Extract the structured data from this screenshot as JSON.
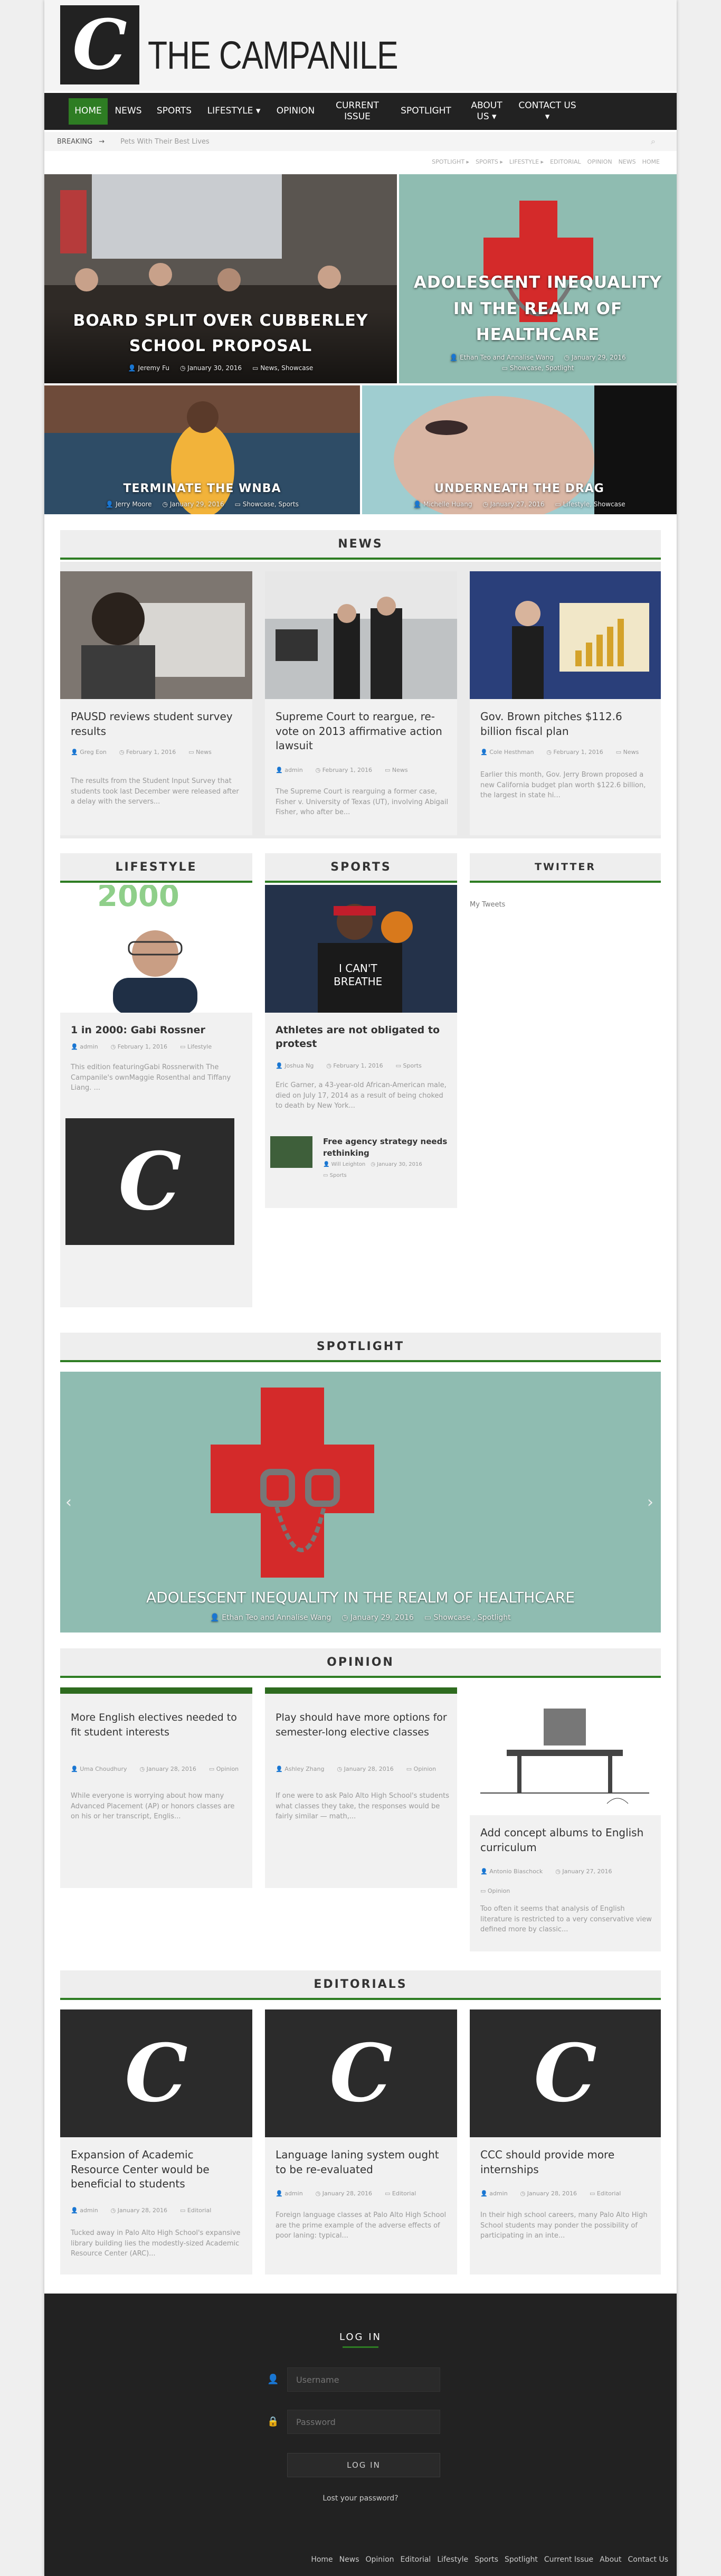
{
  "header": {
    "logo_glyph": "C",
    "site_title": "THE CAMPANILE"
  },
  "nav": [
    {
      "label": "HOME"
    },
    {
      "label": "NEWS"
    },
    {
      "label": "SPORTS"
    },
    {
      "label": "LIFESTYLE ▾"
    },
    {
      "label": "OPINION"
    },
    {
      "label": "CURRENT ISSUE"
    },
    {
      "label": "SPOTLIGHT"
    },
    {
      "label": "ABOUT US ▾"
    },
    {
      "label": "CONTACT US ▾"
    }
  ],
  "breaking": {
    "label": "BREAKING",
    "ticker": "Pets With Their Best Lives"
  },
  "crumbs": [
    "SPOTLIGHT ▸",
    "SPORTS ▸",
    "LIFESTYLE ▸",
    "EDITORIAL",
    "OPINION",
    "NEWS",
    "HOME"
  ],
  "hero": [
    {
      "title": "BOARD SPLIT OVER CUBBERLEY SCHOOL PROPOSAL",
      "author": "Jeremy Fu",
      "date": "January 30, 2016",
      "cats": "News, Showcase"
    },
    {
      "title": "ADOLESCENT INEQUALITY IN THE REALM OF HEALTHCARE",
      "author": "Ethan Teo and Annalise Wang",
      "date": "January 29, 2016",
      "cats": "Showcase, Spotlight"
    },
    {
      "title": "TERMINATE THE WNBA",
      "author": "Jerry Moore",
      "date": "January 29, 2016",
      "cats": "Showcase, Sports"
    },
    {
      "title": "UNDERNEATH THE DRAG",
      "author": "Michelle Huang",
      "date": "January 27, 2016",
      "cats": "Lifestyle, Showcase"
    }
  ],
  "news": {
    "title": "NEWS",
    "items": [
      {
        "title": "PAUSD reviews student survey results",
        "author": "Greg Eon",
        "date": "February 1, 2016",
        "cat": "News",
        "excerpt": "The results from the Student Input Survey that students took last December were released after a delay with the servers..."
      },
      {
        "title": "Supreme Court to reargue, re-vote on 2013 affirmative action lawsuit",
        "author": "admin",
        "date": "February 1, 2016",
        "cat": "News",
        "excerpt": "The Supreme Court is rearguing a former case, Fisher v. University of Texas (UT), involving Abigail Fisher, who after be..."
      },
      {
        "title": "Gov. Brown pitches $112.6 billion fiscal plan",
        "author": "Cole Hesthman",
        "date": "February 1, 2016",
        "cat": "News",
        "excerpt": "Earlier this month, Gov. Jerry Brown proposed a new California budget plan worth $122.6 billion, the largest in state hi..."
      }
    ]
  },
  "lifestyle": {
    "title": "LIFESTYLE",
    "item": {
      "title": "1 in 2000: Gabi Rossner",
      "author": "admin",
      "date": "February 1, 2016",
      "cat": "Lifestyle",
      "excerpt": "This edition featuringGabi Rossnerwith The Campanile's ownMaggie Rosenthal and Tiffany Liang. ...",
      "banner": "2000"
    }
  },
  "sports": {
    "title": "SPORTS",
    "item": {
      "title": "Athletes are not obligated to protest",
      "author": "Joshua Ng",
      "date": "February 1, 2016",
      "cat": "Sports",
      "excerpt": "Eric Garner, a 43-year-old African-American male, died on July 17, 2014 as a result of being choked to death by New York...",
      "shirt": "I CAN'T BREATHE"
    },
    "small": {
      "title": "Free agency strategy needs rethinking",
      "author": "Will Leighton",
      "date": "January 30, 2016",
      "cat": "Sports"
    }
  },
  "twitter": {
    "title": "TWITTER",
    "link": "My Tweets"
  },
  "spotlight": {
    "title": "SPOTLIGHT",
    "headline": "ADOLESCENT INEQUALITY IN THE REALM OF HEALTHCARE",
    "author": "Ethan Teo  and Annalise Wang",
    "date": "January 29, 2016",
    "cats": "Showcase , Spotlight",
    "prev": "‹",
    "next": "›"
  },
  "opinion": {
    "title": "OPINION",
    "items": [
      {
        "title": "More English electives needed to fit student interests",
        "author": "Uma Choudhury",
        "date": "January 28, 2016",
        "cat": "Opinion",
        "excerpt": "While everyone is worrying about how many Advanced Placement (AP) or honors classes are on his or her transcript, Englis..."
      },
      {
        "title": "Play should have more options for semester-long elective classes",
        "author": "Ashley Zhang",
        "date": "January 28, 2016",
        "cat": "Opinion",
        "excerpt": "If one were to ask Palo Alto High School's students what classes they take, the responses would be fairly similar — math,..."
      },
      {
        "title": "Add concept albums to English curriculum",
        "author": "Antonio Biaschock",
        "date": "January 27, 2016",
        "cat": "Opinion",
        "excerpt": "Too often it seems that analysis of English literature is restricted to a very conservative view defined more by classic..."
      }
    ]
  },
  "editorials": {
    "title": "EDITORIALS",
    "items": [
      {
        "title": "Expansion of Academic Resource Center would be beneficial to students",
        "author": "admin",
        "date": "January 28, 2016",
        "cat": "Editorial",
        "excerpt": "Tucked away in Palo Alto High School's expansive library building lies the modestly-sized Academic Resource Center (ARC)..."
      },
      {
        "title": "Language laning system ought to be re-evaluated",
        "author": "admin",
        "date": "January 28, 2016",
        "cat": "Editorial",
        "excerpt": "Foreign language classes at Palo Alto High School are the prime example of the adverse effects of poor laning: typical..."
      },
      {
        "title": "CCC should provide more internships",
        "author": "admin",
        "date": "January 28, 2016",
        "cat": "Editorial",
        "excerpt": "In their high school careers, many Palo Alto High School students may ponder the possibility of participating in an inte..."
      }
    ]
  },
  "footer": {
    "title": "LOG IN",
    "username": "Username",
    "password": "Password",
    "button": "LOG IN",
    "lost": "Lost your password?",
    "links": [
      "Home",
      "News",
      "Opinion",
      "Editorial",
      "Lifestyle",
      "Sports",
      "Spotlight",
      "Current Issue",
      "About",
      "Contact Us"
    ]
  },
  "colors": {
    "accent": "#2e7d23",
    "nav_bg": "#222222",
    "footer_bg": "#222222",
    "spotlight_bg": "#8fbcb1"
  }
}
